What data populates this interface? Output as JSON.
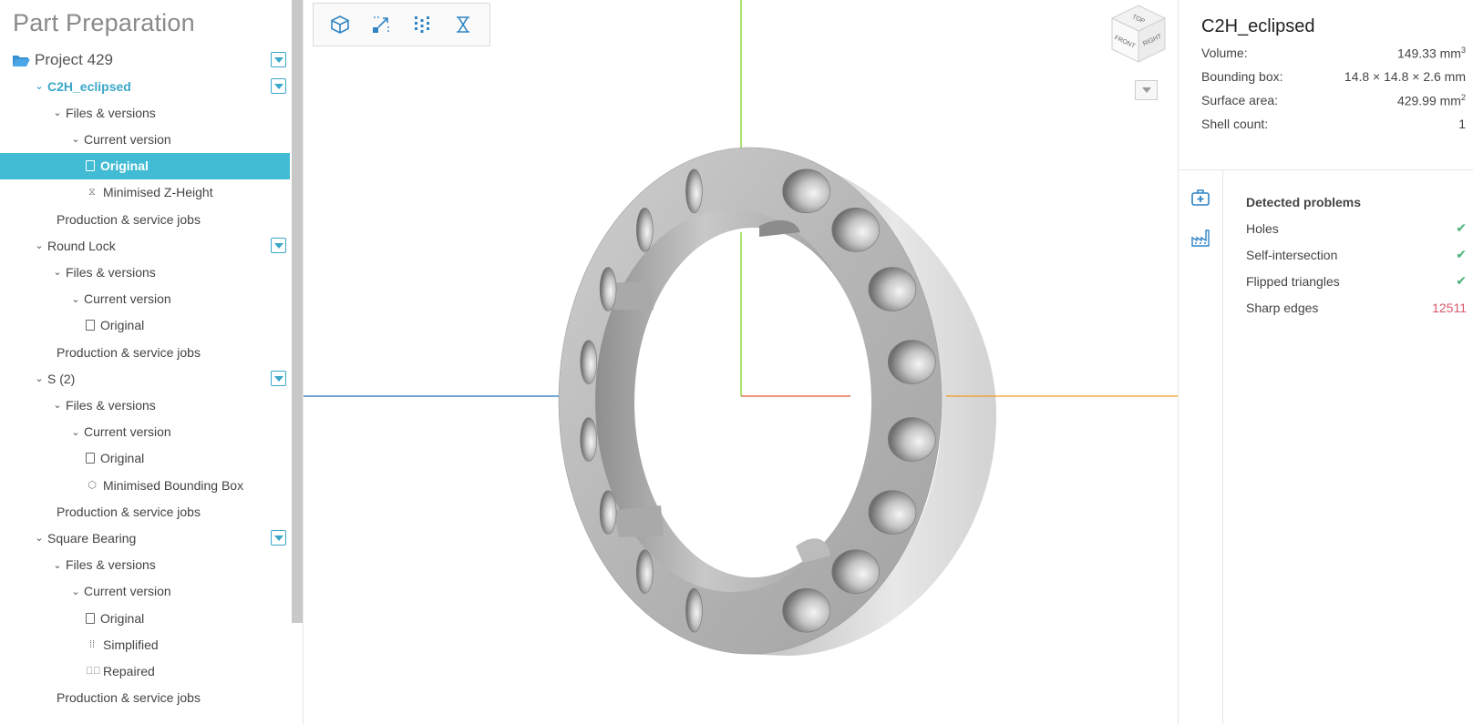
{
  "sidebar": {
    "title": "Part Preparation",
    "project": "Project 429",
    "rows": [
      {
        "label": "C2H_eclipsed",
        "level": 1,
        "kind": "part",
        "active": true
      },
      {
        "label": "Files & versions",
        "level": 2,
        "kind": "group"
      },
      {
        "label": "Current version",
        "level": 3,
        "kind": "group"
      },
      {
        "label": "Original",
        "level": 4,
        "kind": "file",
        "selected": true
      },
      {
        "label": "Minimised Z-Height",
        "level": 4,
        "kind": "zheight"
      },
      {
        "label": "Production & service jobs",
        "level": 2,
        "kind": "leaf"
      },
      {
        "label": "Round Lock",
        "level": 1,
        "kind": "part"
      },
      {
        "label": "Files & versions",
        "level": 2,
        "kind": "group"
      },
      {
        "label": "Current version",
        "level": 3,
        "kind": "group"
      },
      {
        "label": "Original",
        "level": 4,
        "kind": "file"
      },
      {
        "label": "Production & service jobs",
        "level": 2,
        "kind": "leaf"
      },
      {
        "label": "S (2)",
        "level": 1,
        "kind": "part"
      },
      {
        "label": "Files & versions",
        "level": 2,
        "kind": "group"
      },
      {
        "label": "Current version",
        "level": 3,
        "kind": "group"
      },
      {
        "label": "Original",
        "level": 4,
        "kind": "file"
      },
      {
        "label": "Minimised Bounding Box",
        "level": 4,
        "kind": "box"
      },
      {
        "label": "Production & service jobs",
        "level": 2,
        "kind": "leaf"
      },
      {
        "label": "Square Bearing",
        "level": 1,
        "kind": "part"
      },
      {
        "label": "Files & versions",
        "level": 2,
        "kind": "group"
      },
      {
        "label": "Current version",
        "level": 3,
        "kind": "group"
      },
      {
        "label": "Original",
        "level": 4,
        "kind": "file"
      },
      {
        "label": "Simplified",
        "level": 4,
        "kind": "simplified"
      },
      {
        "label": "Repaired",
        "level": 4,
        "kind": "repaired"
      },
      {
        "label": "Production & service jobs",
        "level": 2,
        "kind": "leaf"
      }
    ]
  },
  "viewport": {
    "toolbar": [
      "view-3d-icon",
      "scale-icon",
      "point-cloud-icon",
      "z-height-icon"
    ],
    "viewcube": {
      "top": "TOP",
      "front": "FRONT",
      "right": "RIGHT"
    }
  },
  "part": {
    "name": "C2H_eclipsed",
    "volume_label": "Volume:",
    "volume_value": "149.33 mm",
    "bbox_label": "Bounding box:",
    "bbox_value": "14.8 × 14.8 × 2.6 mm",
    "area_label": "Surface area:",
    "area_value": "429.99 mm",
    "shell_label": "Shell count:",
    "shell_value": "1",
    "unit_exp_volume": "3",
    "unit_exp_area": "2"
  },
  "problems": {
    "title": "Detected problems",
    "items": [
      {
        "label": "Holes",
        "status": "✔"
      },
      {
        "label": "Self-intersection",
        "status": "✔"
      },
      {
        "label": "Flipped triangles",
        "status": "✔"
      },
      {
        "label": "Sharp edges",
        "status": "12511"
      }
    ]
  },
  "colors": {
    "accent": "#42bcd4",
    "error": "#d9586b",
    "ok": "#4ab37a"
  }
}
